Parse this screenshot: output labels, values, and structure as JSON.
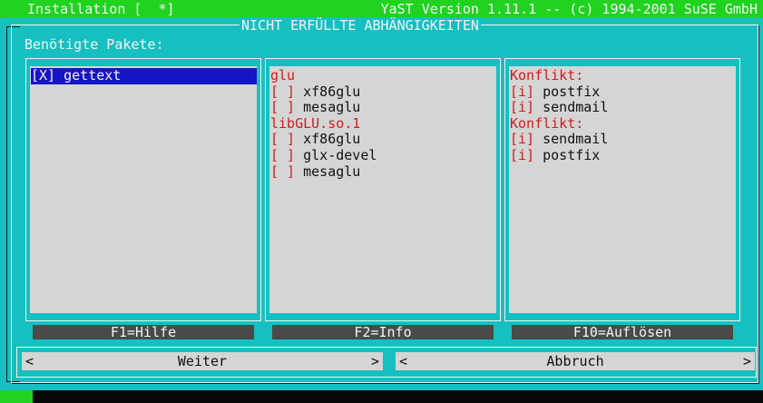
{
  "topbar": {
    "left": "Installation [  *]",
    "right": "YaST Version 1.11.1 -- (c) 1994-2001 SuSE GmbH"
  },
  "dialog": {
    "title": "NICHT ERFÜLLTE ABHÄNGIGKEITEN",
    "subtitle": "Benötigte Pakete:"
  },
  "packages": [
    {
      "label": "[X] gettext",
      "selected": true
    }
  ],
  "dependencies": [
    {
      "text": "glu",
      "style": "red"
    },
    {
      "text": "[ ]",
      "rest": " xf86glu"
    },
    {
      "text": "[ ]",
      "rest": " mesaglu"
    },
    {
      "text": "libGLU.so.1",
      "style": "red"
    },
    {
      "text": "[ ]",
      "rest": " xf86glu"
    },
    {
      "text": "[ ]",
      "rest": " glx-devel"
    },
    {
      "text": "[ ]",
      "rest": " mesaglu"
    }
  ],
  "conflicts": [
    {
      "text": "Konflikt:",
      "style": "red"
    },
    {
      "text": "[i]",
      "rest": " postfix"
    },
    {
      "text": "[i]",
      "rest": " sendmail"
    },
    {
      "text": "Konflikt:",
      "style": "red"
    },
    {
      "text": "[i]",
      "rest": " sendmail"
    },
    {
      "text": "[i]",
      "rest": " postfix"
    }
  ],
  "fkeys": {
    "help": "F1=Hilfe",
    "info": "F2=Info",
    "resolve": "F10=Auflösen"
  },
  "buttons": {
    "next": "Weiter",
    "cancel": "Abbruch",
    "left_arrow": "<",
    "right_arrow": ">"
  },
  "colors": {
    "background": "#17c0c0",
    "titlebar": "#1fd31f",
    "highlight": "#1515c8",
    "dependency_red": "#d01c1c"
  }
}
